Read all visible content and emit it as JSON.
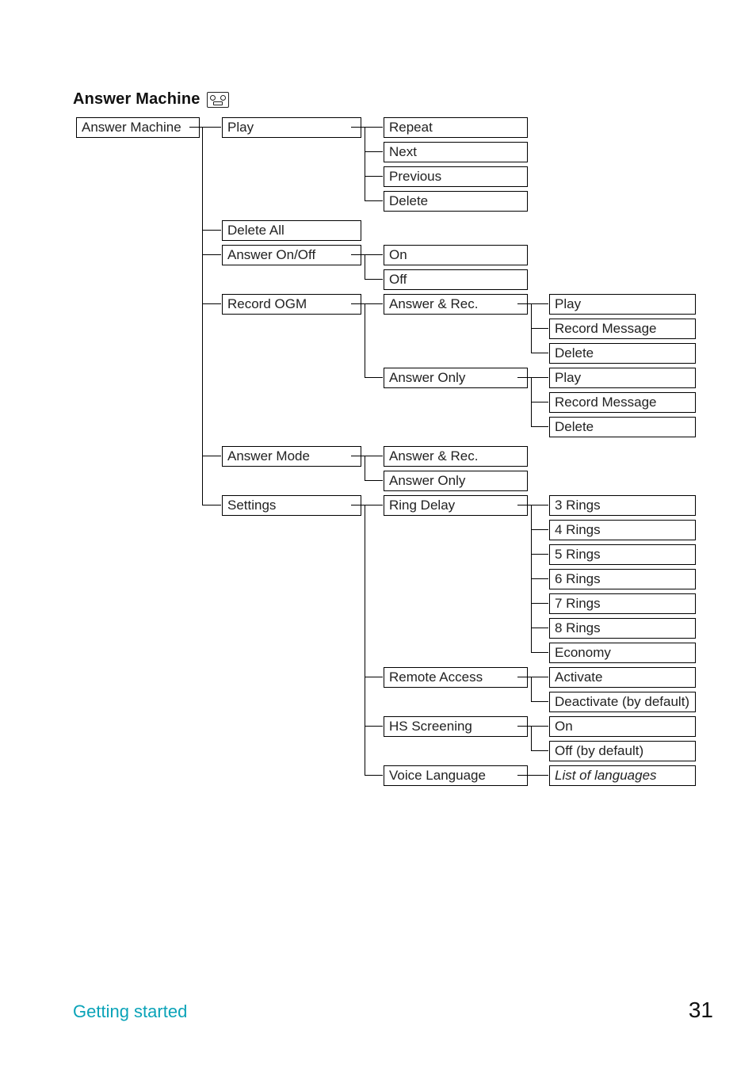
{
  "title": "Answer Machine",
  "root": "Answer Machine",
  "menu": {
    "play": {
      "label": "Play",
      "children": [
        "Repeat",
        "Next",
        "Previous",
        "Delete"
      ]
    },
    "delete_all": {
      "label": "Delete All"
    },
    "answer_onoff": {
      "label": "Answer On/Off",
      "children": [
        "On",
        "Off"
      ]
    },
    "record_ogm": {
      "label": "Record OGM",
      "children": {
        "answer_rec": {
          "label": "Answer & Rec.",
          "sub": [
            "Play",
            "Record Message",
            "Delete"
          ]
        },
        "answer_only": {
          "label": "Answer Only",
          "sub": [
            "Play",
            "Record Message",
            "Delete"
          ]
        }
      }
    },
    "answer_mode": {
      "label": "Answer Mode",
      "children": [
        "Answer & Rec.",
        "Answer Only"
      ]
    },
    "settings": {
      "label": "Settings",
      "children": {
        "ring_delay": {
          "label": "Ring Delay",
          "sub": [
            "3 Rings",
            "4 Rings",
            "5 Rings",
            "6 Rings",
            "7 Rings",
            "8 Rings",
            "Economy"
          ]
        },
        "remote_access": {
          "label": "Remote Access",
          "sub": [
            "Activate",
            "Deactivate (by default)"
          ]
        },
        "hs_screening": {
          "label": "HS Screening",
          "sub": [
            "On",
            "Off (by default)"
          ]
        },
        "voice_language": {
          "label": "Voice Language",
          "sub": [
            "List of languages"
          ]
        }
      }
    }
  },
  "footer": {
    "section": "Getting started",
    "page": "31"
  }
}
